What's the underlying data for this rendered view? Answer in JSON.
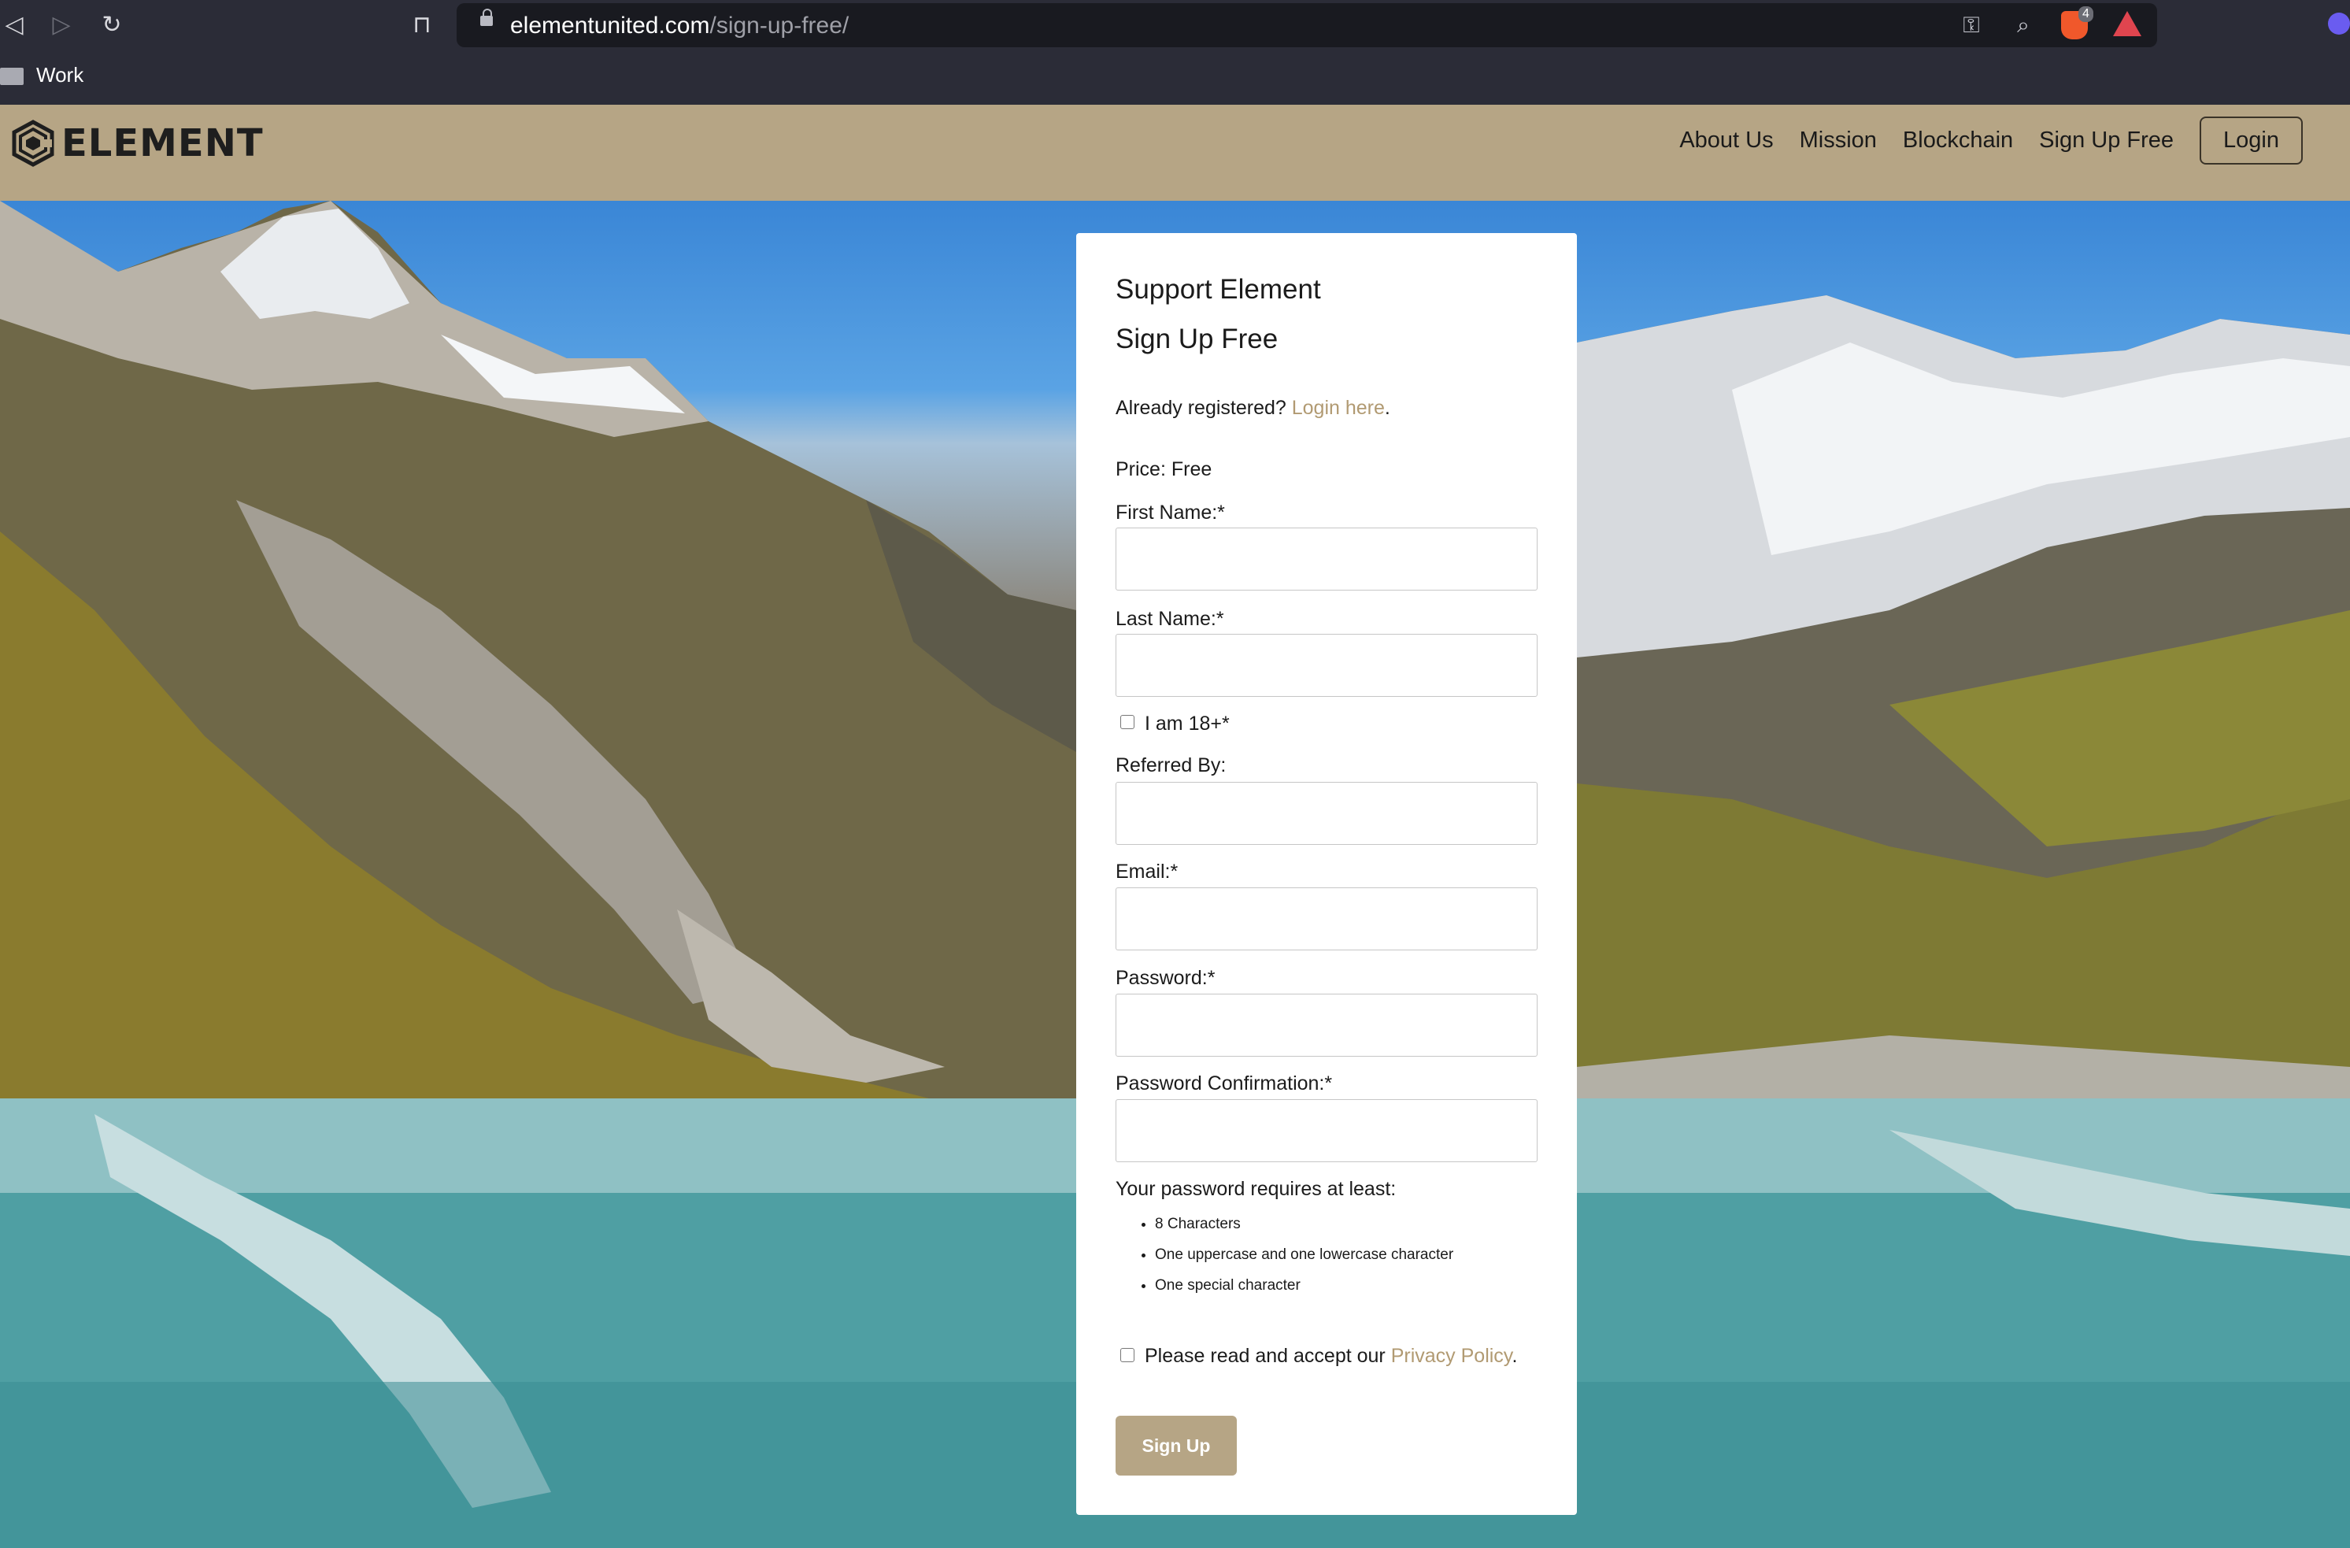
{
  "browser": {
    "url_domain": "elementunited.com",
    "url_path": "/sign-up-free/",
    "brave_badge_count": "4",
    "bookmark_folder": "Work"
  },
  "site": {
    "logo_text": "ELEMENT",
    "nav": {
      "about": "About Us",
      "mission": "Mission",
      "blockchain": "Blockchain",
      "signup": "Sign Up Free",
      "login": "Login"
    }
  },
  "form": {
    "heading1": "Support Element",
    "heading2": "Sign Up Free",
    "already_registered": "Already registered?",
    "login_link": "Login here",
    "price": "Price: Free",
    "first_name_label": "First Name:*",
    "first_name_value": "",
    "last_name_label": "Last Name:*",
    "last_name_value": "",
    "age_label": "I am 18+*",
    "referred_label": "Referred By:",
    "referred_value": "",
    "email_label": "Email:*",
    "email_value": "",
    "password_label": "Password:*",
    "password_value": "",
    "password_confirm_label": "Password Confirmation:*",
    "password_confirm_value": "",
    "requirements_title": "Your password requires at least:",
    "requirements": [
      "8 Characters",
      "One uppercase and one lowercase character",
      "One special character"
    ],
    "privacy_prefix": "Please read and accept our",
    "privacy_link": "Privacy Policy",
    "submit_label": "Sign Up"
  },
  "colors": {
    "brand_tan": "#b6a585",
    "link": "#b19a72"
  }
}
